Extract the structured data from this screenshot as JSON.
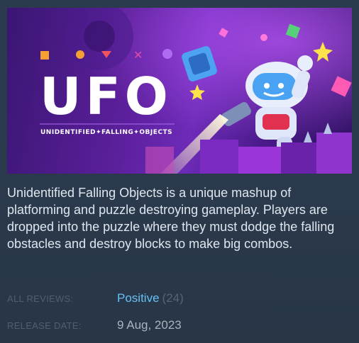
{
  "capsule": {
    "logo_text": "UFO",
    "subtitle": "UNIDENTIFIED✦FALLING✦OBJECTS",
    "colors": {
      "logo": "#ffffff",
      "accent_orange": "#f5a030",
      "accent_red": "#f0545a",
      "accent_pink": "#e04aa8",
      "accent_purple": "#b06cf0"
    }
  },
  "description": "Unidentified Falling Objects is a unique mashup of platforming and puzzle destroying gameplay. Players are dropped into the puzzle where they must dodge the falling obstacles and destroy blocks to make big combos.",
  "reviews": {
    "label": "ALL REVIEWS:",
    "summary": "Positive",
    "count": "(24)",
    "summary_color": "#66c0f4"
  },
  "release": {
    "label": "RELEASE DATE:",
    "date": "9 Aug, 2023"
  }
}
